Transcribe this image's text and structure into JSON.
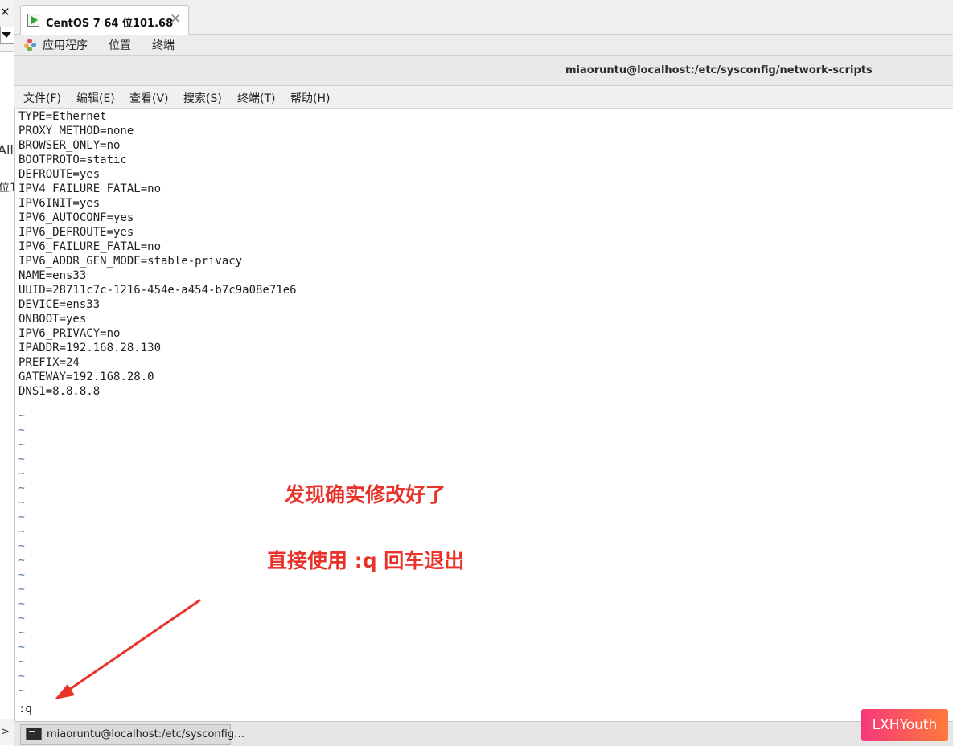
{
  "host": {
    "close_glyph": "✕",
    "left_text_1": "All",
    "left_text_2": "位1",
    "left_arrow": ">"
  },
  "vm_tab": {
    "title": "CentOS 7 64 位101.68",
    "close_glyph": "✕"
  },
  "gnome_bar": {
    "apps": "应用程序",
    "places": "位置",
    "terminal": "终端"
  },
  "terminal": {
    "window_title": "miaoruntu@localhost:/etc/sysconfig/network-scripts",
    "menu": [
      "文件(F)",
      "编辑(E)",
      "查看(V)",
      "搜索(S)",
      "终端(T)",
      "帮助(H)"
    ],
    "lines": [
      "TYPE=Ethernet",
      "PROXY_METHOD=none",
      "BROWSER_ONLY=no",
      "BOOTPROTO=static",
      "DEFROUTE=yes",
      "IPV4_FAILURE_FATAL=no",
      "IPV6INIT=yes",
      "IPV6_AUTOCONF=yes",
      "IPV6_DEFROUTE=yes",
      "IPV6_FAILURE_FATAL=no",
      "IPV6_ADDR_GEN_MODE=stable-privacy",
      "NAME=ens33",
      "UUID=28711c7c-1216-454e-a454-b7c9a08e71e6",
      "DEVICE=ens33",
      "ONBOOT=yes",
      "IPV6_PRIVACY=no",
      "IPADDR=192.168.28.130",
      "PREFIX=24",
      "GATEWAY=192.168.28.0",
      "DNS1=8.8.8.8"
    ],
    "tilde": "~",
    "tilde_count": 20,
    "command": ":q"
  },
  "annotations": {
    "line1": "发现确实修改好了",
    "line2": "直接使用 :q  回车退出"
  },
  "taskbar": {
    "item": "miaoruntu@localhost:/etc/sysconfig…"
  },
  "watermark": "LXHYouth",
  "colors": {
    "annotation": "#e8332b",
    "tilde": "#4a6fa0",
    "watermark_start": "#f6387a",
    "watermark_end": "#ff7a3a"
  }
}
